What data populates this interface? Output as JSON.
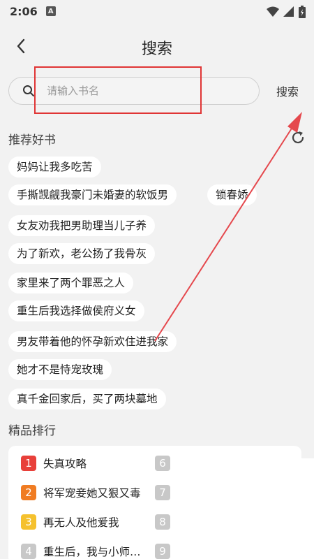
{
  "status_bar": {
    "time": "2:06",
    "notif_badge": "A"
  },
  "header": {
    "title": "搜索"
  },
  "search": {
    "placeholder": "请输入书名",
    "button_label": "搜索"
  },
  "recommend": {
    "title": "推荐好书",
    "tags": [
      "妈妈让我多吃苦",
      "手撕觊觎我豪门未婚妻的软饭男",
      "锁春娇",
      "女友劝我把男助理当儿子养",
      "为了新欢，老公扬了我骨灰",
      "家里来了两个罪恶之人",
      "重生后我选择做侯府义女",
      "男友带着他的怀孕新欢住进我家",
      "她才不是恃宠玫瑰",
      "真千金回家后，买了两块墓地"
    ]
  },
  "ranking": {
    "title": "精品排行",
    "left": [
      {
        "num": "1",
        "title": "失真攻略",
        "color": "#e8403a"
      },
      {
        "num": "2",
        "title": "将军宠妾她又狠又毒",
        "color": "#f07c22"
      },
      {
        "num": "3",
        "title": "再无人及他爱我",
        "color": "#f5c12e"
      },
      {
        "num": "4",
        "title": "重生后，我与小师…",
        "color": "#c8c8c8"
      }
    ],
    "right": [
      {
        "num": "6",
        "color": "#c8c8c8"
      },
      {
        "num": "7",
        "color": "#c8c8c8"
      },
      {
        "num": "8",
        "color": "#c8c8c8"
      },
      {
        "num": "9",
        "color": "#c8c8c8"
      }
    ]
  }
}
